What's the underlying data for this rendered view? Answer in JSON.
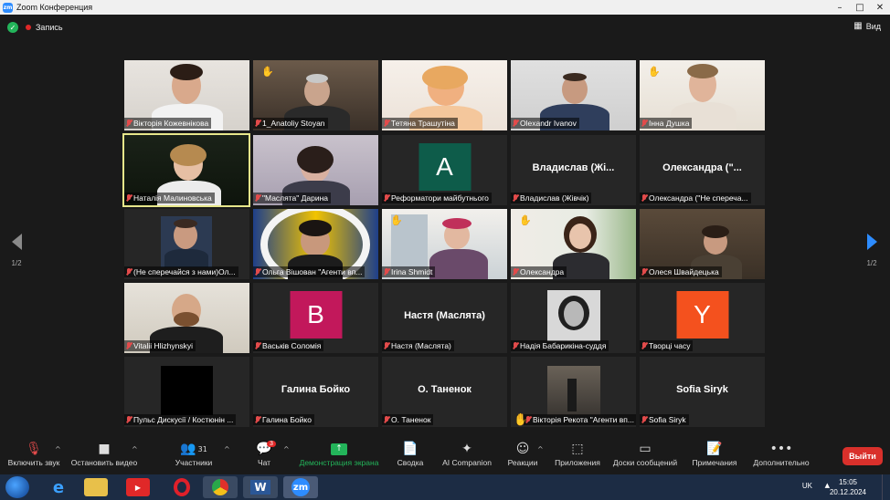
{
  "window": {
    "title": "Zoom Конференция",
    "logo": "zm"
  },
  "topbar": {
    "record_label": "Запись",
    "view_label": "Вид"
  },
  "pager": {
    "left": "1/2",
    "right": "1/2"
  },
  "tiles": [
    {
      "name": "Вікторія Кожевнікова"
    },
    {
      "name": "1_Anatoliy Stoyan"
    },
    {
      "name": "Тетяна Трашутіна"
    },
    {
      "name": "Olexandr Ivanov"
    },
    {
      "name": "Інна Душка"
    },
    {
      "name": "Наталія Малиновська"
    },
    {
      "name": "\"Маслята\" Дарина"
    },
    {
      "name": "Реформатори майбутнього",
      "avatar": "A",
      "avatar_color": "#0e5c4a"
    },
    {
      "name": "Владислав (Жівчік)",
      "big": "Владислав (Жі..."
    },
    {
      "name": "Олександра (\"Не спереча...",
      "big": "Олександра (\"..."
    },
    {
      "name": "(Не сперечайся з нами)Ол..."
    },
    {
      "name": "Ольга Вішован \"Агенти вп..."
    },
    {
      "name": "Irina Shmidt"
    },
    {
      "name": "Олександра"
    },
    {
      "name": "Олеся Швайдецька"
    },
    {
      "name": "Vitalii Hlizhynskyi"
    },
    {
      "name": "Васьків Соломія",
      "avatar": "B",
      "avatar_color": "#c2185b"
    },
    {
      "name": "Настя (Маслята)",
      "big": "Настя (Маслята)"
    },
    {
      "name": "Надія Бабарикіна-суддя"
    },
    {
      "name": "Творці часу",
      "avatar": "Y",
      "avatar_color": "#f4511e"
    },
    {
      "name": "Пульс Дискусії / Костюнін ..."
    },
    {
      "name": "Галина Бойко",
      "big": "Галина Бойко"
    },
    {
      "name": "О. Таненок",
      "big": "О. Таненок"
    },
    {
      "name": "Вікторія Рекота \"Агенти вп..."
    },
    {
      "name": "Sofia Siryk",
      "big": "Sofia Siryk"
    }
  ],
  "toolbar": {
    "audio": "Включить звук",
    "video": "Остановить видео",
    "participants": "Участники",
    "participants_count": "31",
    "chat": "Чат",
    "chat_badge": "3",
    "share": "Демонстрация экрана",
    "summary": "Сводка",
    "ai": "AI Companion",
    "reactions": "Реакции",
    "apps": "Приложения",
    "whiteboards": "Доски сообщений",
    "notes": "Примечания",
    "more": "Дополнительно",
    "leave": "Выйти"
  },
  "taskbar": {
    "lang": "UK",
    "time": "15:05",
    "date": "20.12.2024",
    "word": "W",
    "zoom": "zm"
  },
  "colors": {
    "accent": "#2d8cff",
    "share_green": "#23b45a",
    "leave_red": "#d9302b",
    "speaker_border": "#e6e68a"
  }
}
